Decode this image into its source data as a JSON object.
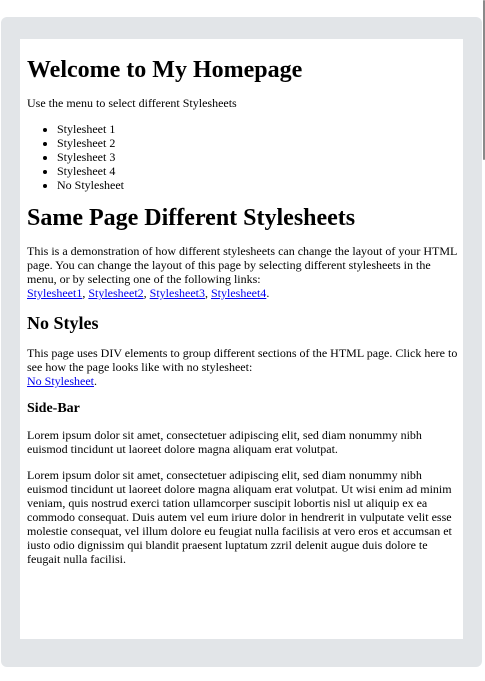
{
  "heading_main": "Welcome to My Homepage",
  "intro": "Use the menu to select different Stylesheets",
  "menu": [
    "Stylesheet 1",
    "Stylesheet 2",
    "Stylesheet 3",
    "Stylesheet 4",
    "No Stylesheet"
  ],
  "heading_same": "Same Page Different Stylesheets",
  "same_text": "This is a demonstration of how different stylesheets can change the layout of your HTML page. You can change the layout of this page by selecting different stylesheets in the menu, or by selecting one of the following links:",
  "links": [
    "Stylesheet1",
    "Stylesheet2",
    "Stylesheet3",
    "Stylesheet4"
  ],
  "separator": ", ",
  "period": ".",
  "heading_nostyles": "No Styles",
  "nostyles_text": "This page uses DIV elements to group different sections of the HTML page. Click here to see how the page looks like with no stylesheet:",
  "nostyles_link": "No Stylesheet",
  "heading_sidebar": "Side-Bar",
  "sidebar_p1": "Lorem ipsum dolor sit amet, consectetuer adipiscing elit, sed diam nonummy nibh euismod tincidunt ut laoreet dolore magna aliquam erat volutpat.",
  "sidebar_p2": "Lorem ipsum dolor sit amet, consectetuer adipiscing elit, sed diam nonummy nibh euismod tincidunt ut laoreet dolore magna aliquam erat volutpat. Ut wisi enim ad minim veniam, quis nostrud exerci tation ullamcorper suscipit lobortis nisl ut aliquip ex ea commodo consequat. Duis autem vel eum iriure dolor in hendrerit in vulputate velit esse molestie consequat, vel illum dolore eu feugiat nulla facilisis at vero eros et accumsan et iusto odio dignissim qui blandit praesent luptatum zzril delenit augue duis dolore te feugait nulla facilisi."
}
